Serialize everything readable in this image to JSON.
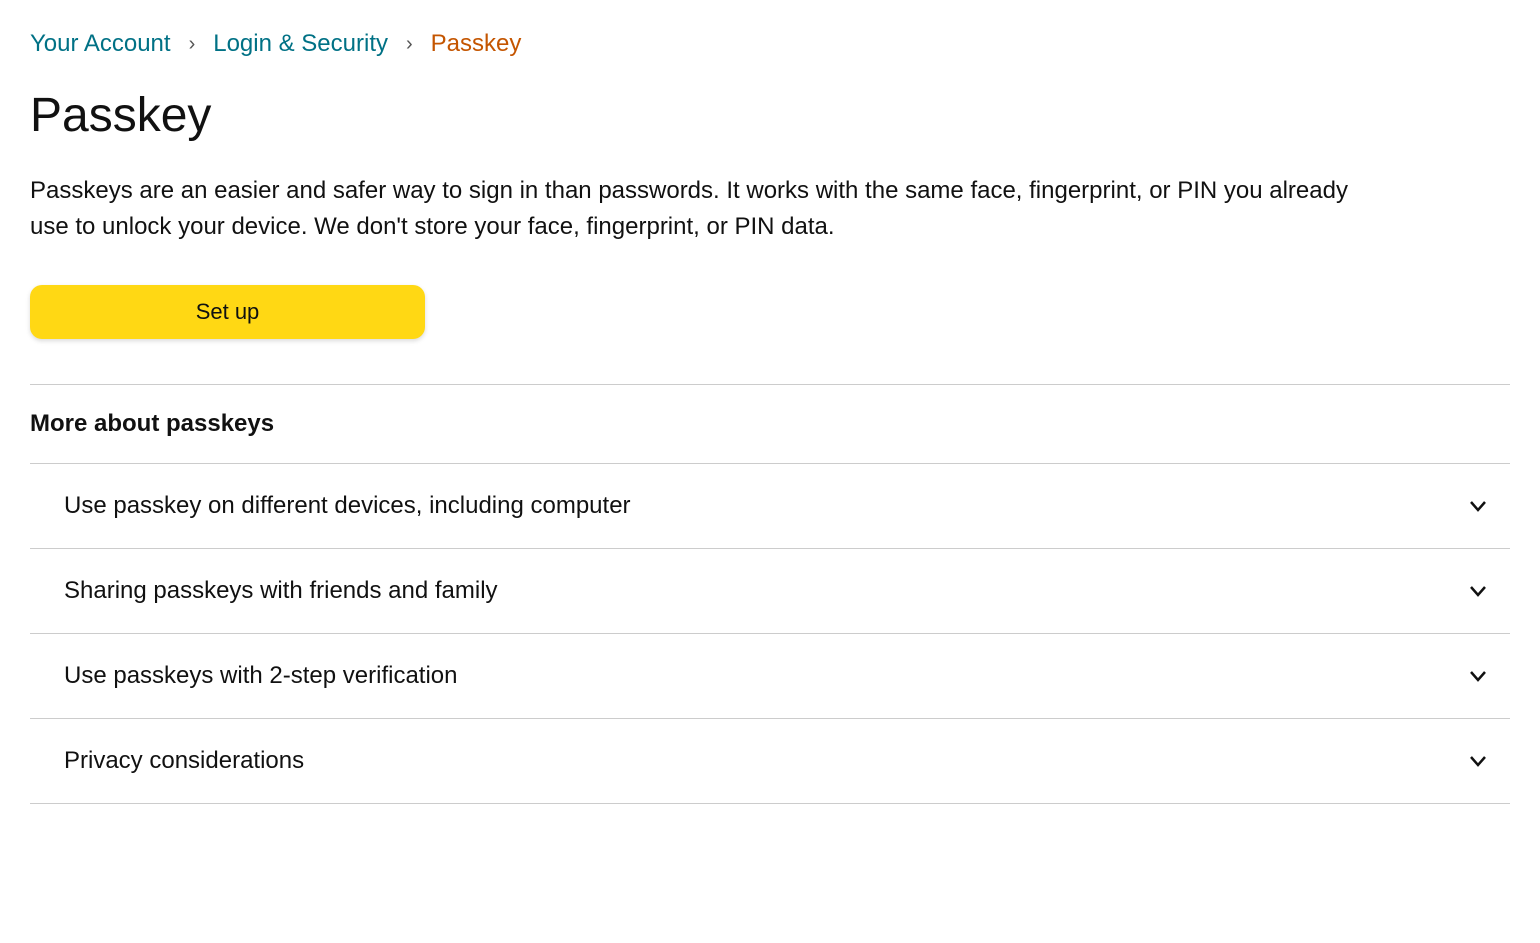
{
  "breadcrumb": {
    "items": [
      {
        "label": "Your Account"
      },
      {
        "label": "Login & Security"
      }
    ],
    "current": "Passkey"
  },
  "page": {
    "title": "Passkey",
    "description": "Passkeys are an easier and safer way to sign in than passwords. It works with the same face, fingerprint, or PIN you already use to unlock your device. We don't store your face, fingerprint, or PIN data.",
    "setup_button": "Set up"
  },
  "more_section": {
    "title": "More about passkeys",
    "items": [
      {
        "label": "Use passkey on different devices, including computer"
      },
      {
        "label": "Sharing passkeys with friends and family"
      },
      {
        "label": "Use passkeys with 2-step verification"
      },
      {
        "label": "Privacy considerations"
      }
    ]
  }
}
